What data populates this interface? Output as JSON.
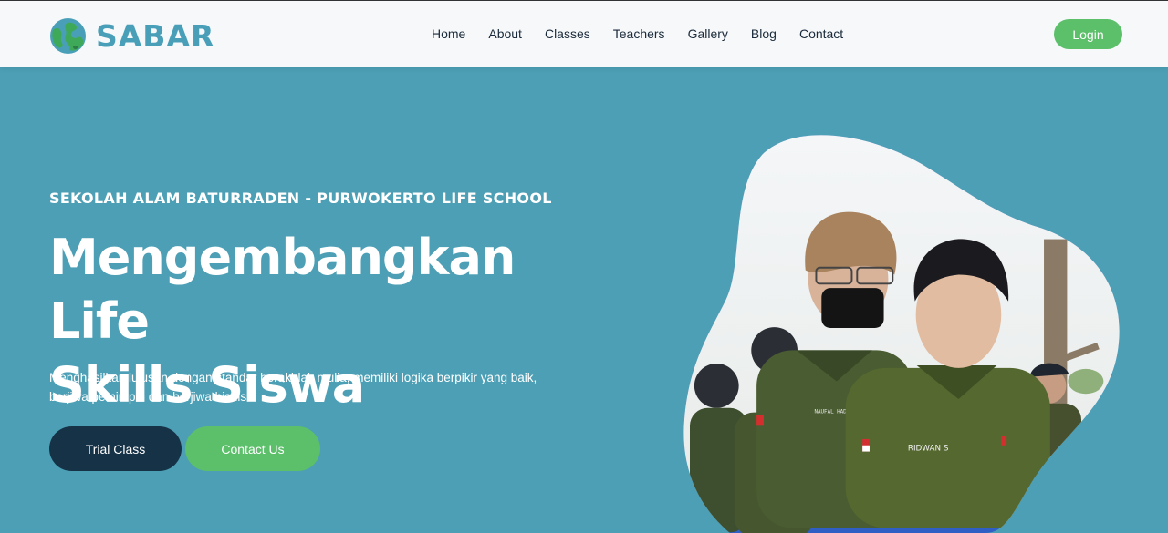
{
  "brand": {
    "name": "SABAR",
    "colors": {
      "primary": "#4a9fb8",
      "dark": "#163247",
      "green": "#5cbf6a",
      "hero_bg": "#4c9fb5"
    }
  },
  "nav": {
    "items": [
      {
        "label": "Home"
      },
      {
        "label": "About"
      },
      {
        "label": "Classes"
      },
      {
        "label": "Teachers"
      },
      {
        "label": "Gallery"
      },
      {
        "label": "Blog"
      },
      {
        "label": "Contact"
      }
    ],
    "login_label": "Login"
  },
  "hero": {
    "subtitle": "SEKOLAH ALAM BATURRADEN - PURWOKERTO LIFE SCHOOL",
    "title_line1": "Mengembangkan Life",
    "title_line2": "Skills Siswa",
    "description": "Menghasilkan lulusan dengan standar berakhlak mulia, memiliki logika berpikir yang baik, berjiwa pemimpin dan berjiwa bisnis.",
    "trial_label": "Trial Class",
    "contact_label": "Contact Us",
    "image_icon": "students-photo",
    "name_tags": [
      "RIDWAN S",
      "NAUFAL HADYAN R"
    ]
  }
}
